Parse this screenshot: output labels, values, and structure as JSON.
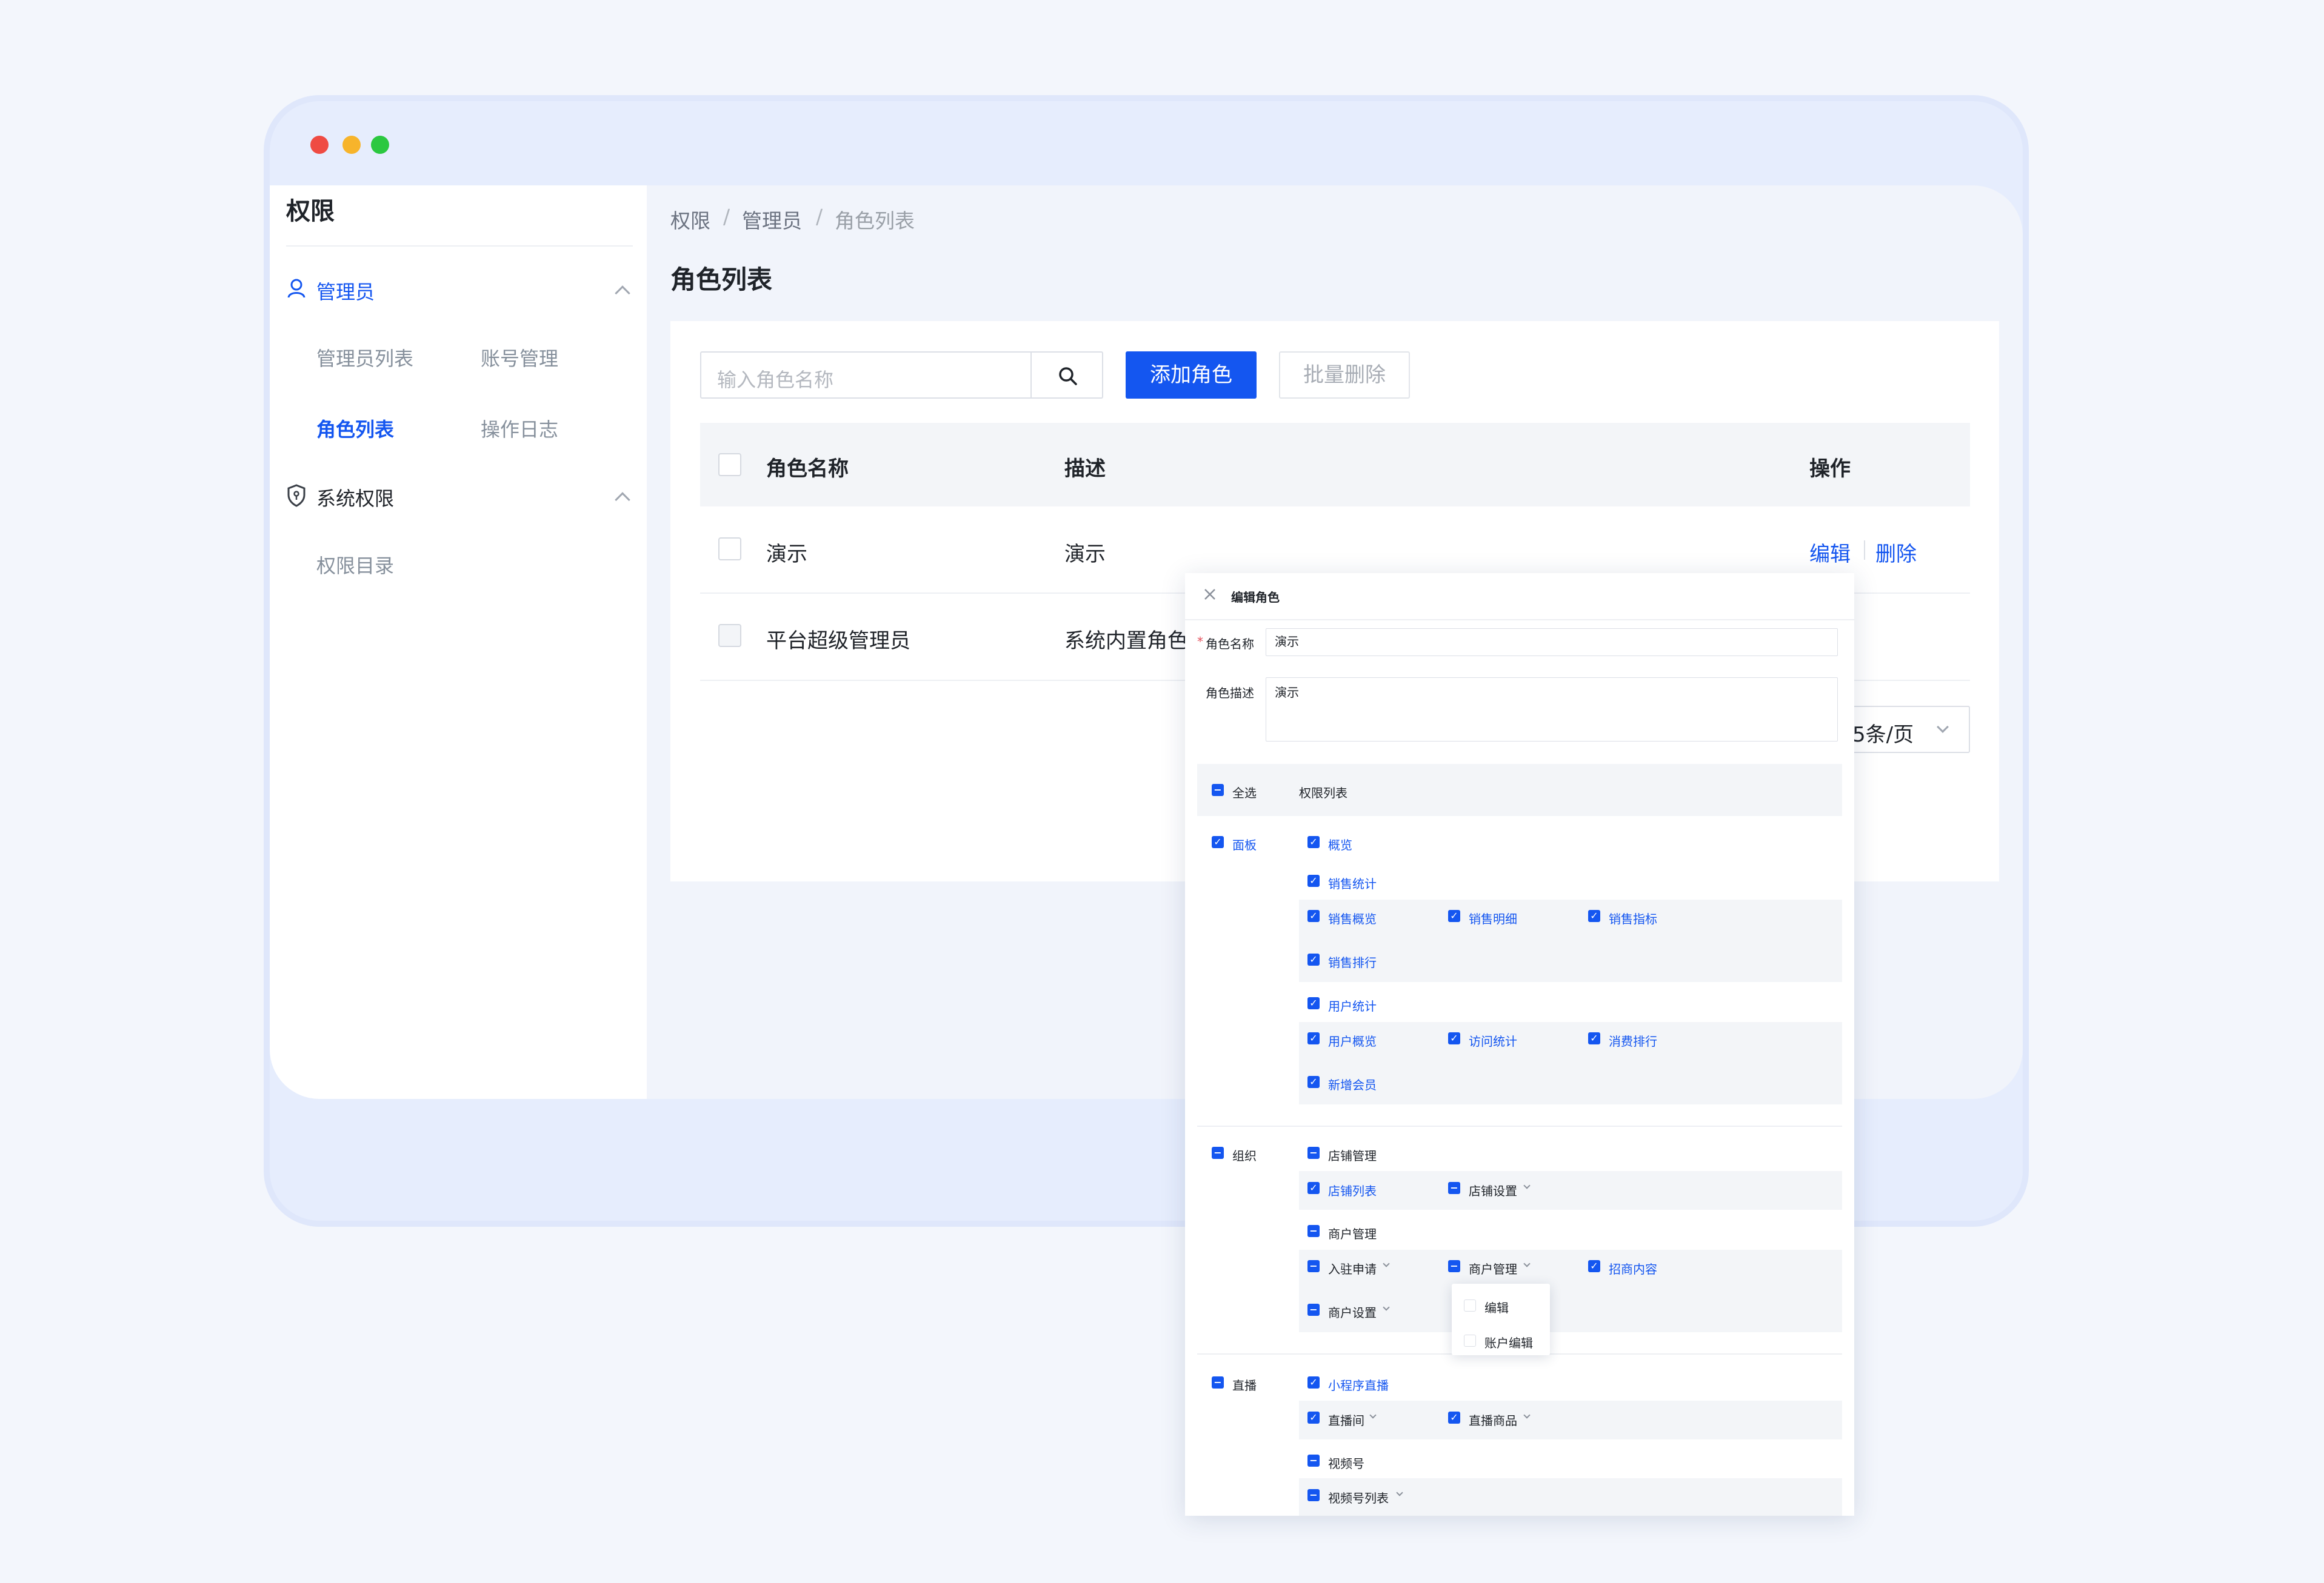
{
  "window": {
    "controls": [
      {
        "name": "close",
        "color": "#ef4b43"
      },
      {
        "name": "minimize",
        "color": "#f7b42b"
      },
      {
        "name": "maximize",
        "color": "#2bc840"
      }
    ]
  },
  "sidebar": {
    "title": "权限",
    "groups": [
      {
        "label": "管理员",
        "icon": "user-icon",
        "active": true,
        "items": [
          {
            "label": "管理员列表"
          },
          {
            "label": "账号管理"
          },
          {
            "label": "角色列表",
            "active": true
          },
          {
            "label": "操作日志"
          }
        ]
      },
      {
        "label": "系统权限",
        "icon": "shield-icon",
        "items": [
          {
            "label": "权限目录"
          }
        ]
      }
    ]
  },
  "breadcrumb": {
    "items": [
      "权限",
      "管理员",
      "角色列表"
    ],
    "separator": "/"
  },
  "page_title": "角色列表",
  "toolbar": {
    "search_placeholder": "输入角色名称",
    "add_label": "添加角色",
    "batch_delete_label": "批量删除"
  },
  "table": {
    "columns": [
      "角色名称",
      "描述",
      "操作"
    ],
    "rows": [
      {
        "name": "演示",
        "desc": "演示",
        "actions": [
          "编辑",
          "删除"
        ]
      },
      {
        "name": "平台超级管理员",
        "desc": "系统内置角色"
      }
    ],
    "page_size": "5条/页"
  },
  "modal": {
    "title": "编辑角色",
    "name_label": "角色名称",
    "required_mark": "*",
    "name_value": "演示",
    "desc_label": "角色描述",
    "desc_value": "演示",
    "select_all": "全选",
    "perm_list": "权限列表",
    "panel": {
      "label": "面板",
      "overview": "概览",
      "sales_stats": "销售统计",
      "sales_items": [
        "销售概览",
        "销售明细",
        "销售指标",
        "销售排行"
      ],
      "user_stats": "用户统计",
      "user_items": [
        "用户概览",
        "访问统计",
        "消费排行",
        "新增会员"
      ]
    },
    "org": {
      "label": "组织",
      "store_mgmt": "店铺管理",
      "store_items": [
        "店铺列表",
        "店铺设置"
      ],
      "merchant_mgmt": "商户管理",
      "merchant_items": [
        "入驻申请",
        "商户管理",
        "招商内容",
        "商户设置"
      ],
      "dropdown_items": [
        "编辑",
        "账户编辑"
      ]
    },
    "live": {
      "label": "直播",
      "mini_live": "小程序直播",
      "mini_items": [
        "直播间",
        "直播商品"
      ],
      "channels": "视频号",
      "channel_items": [
        "视频号列表"
      ]
    }
  }
}
